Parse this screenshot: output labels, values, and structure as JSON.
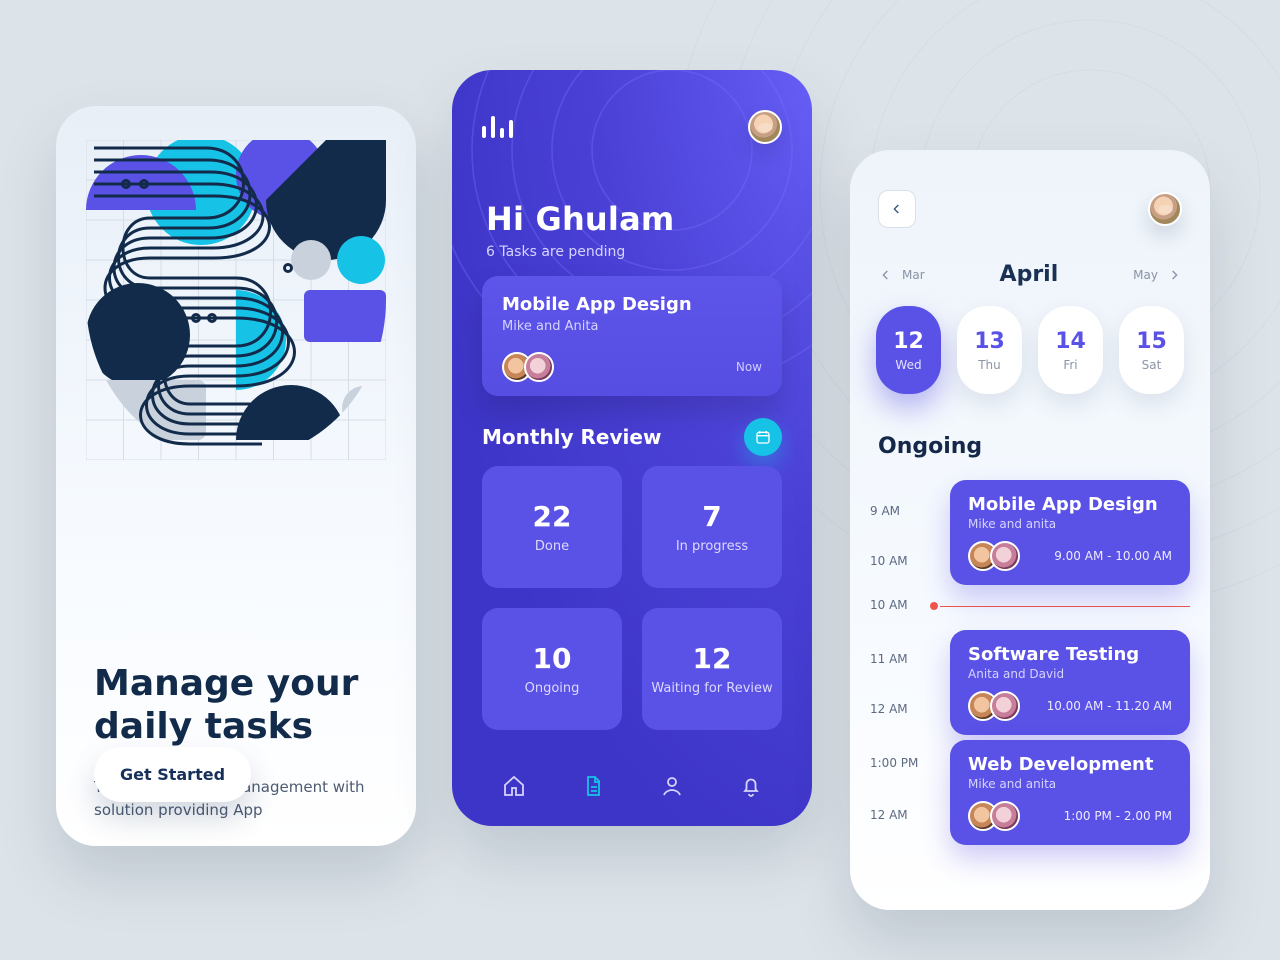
{
  "onboarding": {
    "title": "Manage your daily tasks",
    "subtitle": "Team and Project management with solution providing App",
    "cta": "Get Started"
  },
  "dashboard": {
    "greeting": "Hi Ghulam",
    "pending_text": "6 Tasks are pending",
    "task_card": {
      "title": "Mobile App Design",
      "people": "Mike and Anita",
      "time": "Now"
    },
    "monthly_review": "Monthly Review",
    "stats": [
      {
        "n": "22",
        "l": "Done"
      },
      {
        "n": "7",
        "l": "In progress"
      },
      {
        "n": "10",
        "l": "Ongoing"
      },
      {
        "n": "12",
        "l": "Waiting for Review"
      }
    ],
    "nav": [
      "home",
      "doc",
      "user",
      "bell"
    ]
  },
  "calendar": {
    "prev_month": "Mar",
    "month": "April",
    "next_month": "May",
    "days": [
      {
        "n": "12",
        "l": "Wed",
        "active": true
      },
      {
        "n": "13",
        "l": "Thu",
        "active": false
      },
      {
        "n": "14",
        "l": "Fri",
        "active": false
      },
      {
        "n": "15",
        "l": "Sat",
        "active": false
      }
    ],
    "ongoing_label": "Ongoing",
    "hours": [
      "9 AM",
      "10 AM",
      "11 AM",
      "12 AM",
      "1:00 PM",
      "12 AM"
    ],
    "now_label": "10 AM",
    "events": [
      {
        "title": "Mobile App Design",
        "people": "Mike and anita",
        "time": "9.00 AM - 10.00 AM"
      },
      {
        "title": "Software Testing",
        "people": "Anita and David",
        "time": "10.00 AM - 11.20 AM"
      },
      {
        "title": "Web Development",
        "people": "Mike and anita",
        "time": "1:00 PM - 2.00 PM"
      }
    ]
  },
  "colors": {
    "primary": "#5a51e6",
    "accent": "#16c3e6",
    "deep_navy": "#122b4a"
  }
}
